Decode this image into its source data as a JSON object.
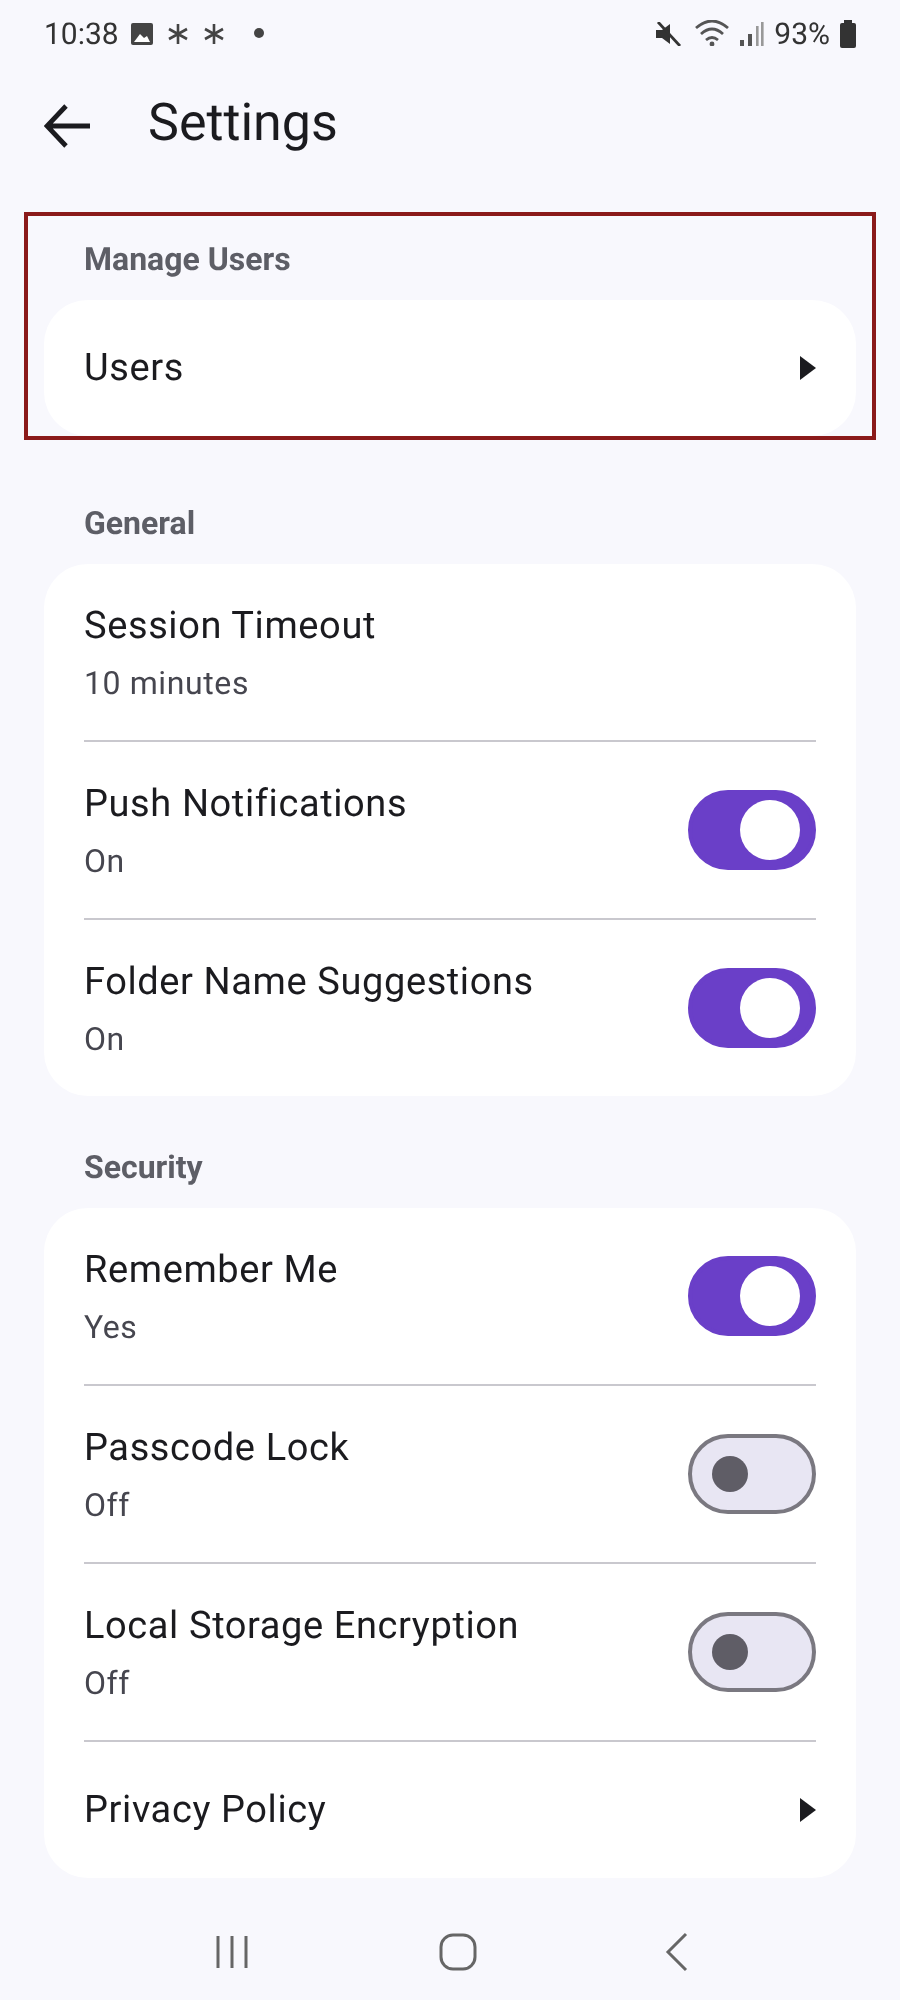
{
  "status_bar": {
    "time": "10:38",
    "battery": "93%"
  },
  "header": {
    "title": "Settings"
  },
  "sections": [
    {
      "title": "Manage Users",
      "highlighted": true,
      "items": [
        {
          "kind": "link",
          "label": "Users"
        }
      ]
    },
    {
      "title": "General",
      "highlighted": false,
      "items": [
        {
          "kind": "value",
          "label": "Session Timeout",
          "value": "10 minutes"
        },
        {
          "kind": "switch",
          "label": "Push Notifications",
          "value": "On",
          "on": true
        },
        {
          "kind": "switch",
          "label": "Folder Name Suggestions",
          "value": "On",
          "on": true
        }
      ]
    },
    {
      "title": "Security",
      "highlighted": false,
      "items": [
        {
          "kind": "switch",
          "label": "Remember Me",
          "value": "Yes",
          "on": true
        },
        {
          "kind": "switch",
          "label": "Passcode Lock",
          "value": "Off",
          "on": false
        },
        {
          "kind": "switch",
          "label": "Local Storage Encryption",
          "value": "Off",
          "on": false
        },
        {
          "kind": "link",
          "label": "Privacy Policy"
        }
      ]
    }
  ]
}
